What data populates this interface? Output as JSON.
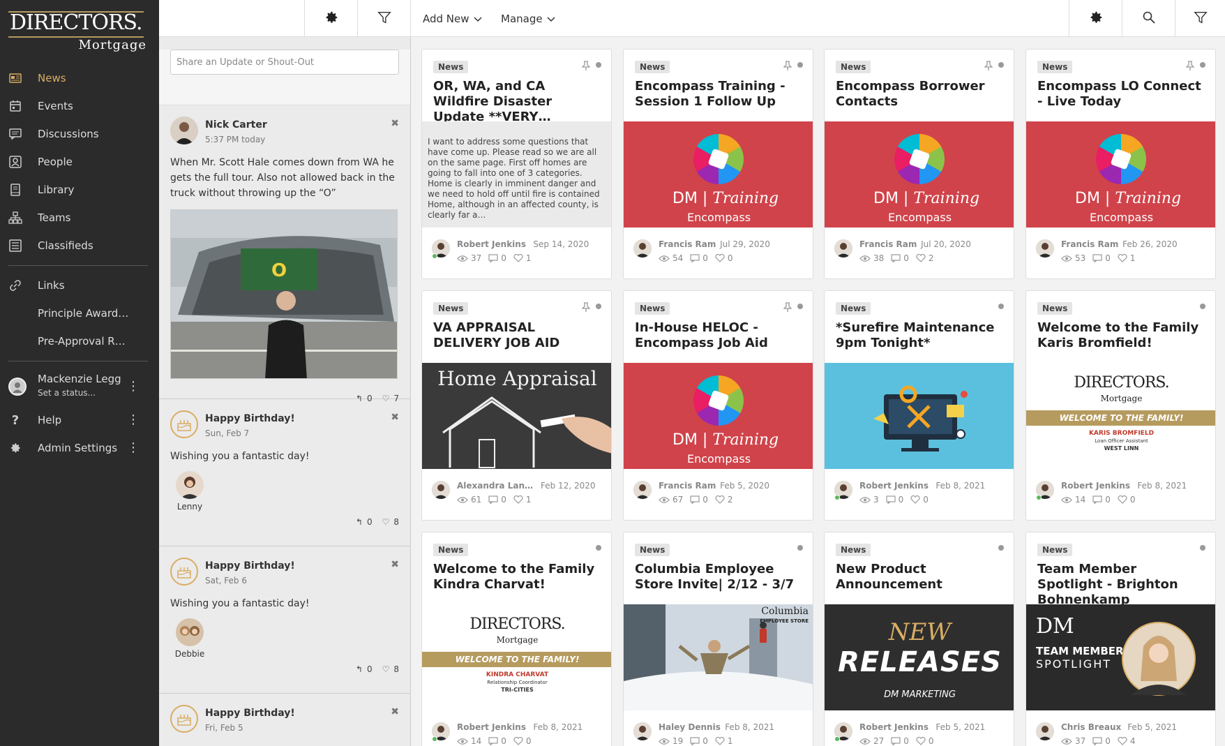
{
  "logo": {
    "top": "DIRECTORS.",
    "bottom": "Mortgage"
  },
  "nav": {
    "items": [
      {
        "label": "News",
        "icon": "newspaper-icon"
      },
      {
        "label": "Events",
        "icon": "calendar-icon"
      },
      {
        "label": "Discussions",
        "icon": "chat-icon"
      },
      {
        "label": "People",
        "icon": "person-icon"
      },
      {
        "label": "Library",
        "icon": "book-icon"
      },
      {
        "label": "Teams",
        "icon": "org-chart-icon"
      },
      {
        "label": "Classifieds",
        "icon": "list-icon"
      }
    ],
    "links_label": "Links",
    "link_items": [
      "Principle Award…",
      "Pre-Approval R…"
    ],
    "user": {
      "name": "Mackenzie Legg",
      "status": "Set a status..."
    },
    "help": "Help",
    "admin": "Admin Settings",
    "active_color": "#d9ad64"
  },
  "topbar": {
    "add_new": "Add New",
    "manage": "Manage"
  },
  "feed": {
    "share_placeholder": "Share an Update or Shout-Out",
    "post1": {
      "name": "Nick Carter",
      "time": "5:37 PM today",
      "text": "When Mr. Scott Hale comes down from WA he gets the full tour. Also not allowed back in the truck without throwing up the “O”",
      "replies": "0",
      "likes": "7"
    },
    "bday1": {
      "title": "Happy Birthday!",
      "date": "Sun, Feb 7",
      "text": "Wishing you a fantastic day!",
      "person": "Lenny",
      "replies": "0",
      "likes": "8"
    },
    "bday2": {
      "title": "Happy Birthday!",
      "date": "Sat, Feb 6",
      "text": "Wishing you a fantastic day!",
      "person": "Debbie",
      "replies": "0",
      "likes": "8"
    },
    "bday3": {
      "title": "Happy Birthday!",
      "date": "Fri, Feb 5"
    }
  },
  "media_text": {
    "dm": "DM",
    "training": "Training",
    "encompass": "Encompass",
    "home_appraisal": "Home Appraisal",
    "welcome_band": "WELCOME TO THE FAMILY!",
    "columbia": "Columbia",
    "columbia_sub": "EMPLOYEE STORE",
    "new": "NEW",
    "releases": "RELEASES",
    "marketing": "DM MARKETING",
    "team_member": "TEAM MEMBER",
    "spotlight": "SPOTLIGHT"
  },
  "cards": [
    {
      "tag": "News",
      "title": "OR, WA, and CA Wildfire Disaster Update **VERY…",
      "excerpt": "I want to address some questions that have come up. Please read so we are all on the same page.    First off homes are going to fall into one of 3 categories.    Home is clearly in imminent danger and we need to hold off until fire is contained Home, although in an affected county, is clearly far a…",
      "author": "Robert Jenkins",
      "date": "Sep 14, 2020",
      "views": "37",
      "comments": "0",
      "likes": "1"
    },
    {
      "tag": "News",
      "title": "Encompass Training - Session 1 Follow Up",
      "author": "Francis Ram",
      "date": "Jul 29, 2020",
      "views": "54",
      "comments": "0",
      "likes": "0"
    },
    {
      "tag": "News",
      "title": "Encompass Borrower Contacts",
      "author": "Francis Ram",
      "date": "Jul 20, 2020",
      "views": "38",
      "comments": "0",
      "likes": "2"
    },
    {
      "tag": "News",
      "title": "Encompass LO Connect - Live Today",
      "author": "Francis Ram",
      "date": "Feb 26, 2020",
      "views": "53",
      "comments": "0",
      "likes": "1"
    },
    {
      "tag": "News",
      "title": "VA APPRAISAL DELIVERY JOB AID",
      "author": "Alexandra Lande…",
      "date": "Feb 12, 2020",
      "views": "61",
      "comments": "0",
      "likes": "1"
    },
    {
      "tag": "News",
      "title": "In-House HELOC - Encompass Job Aid",
      "author": "Francis Ram",
      "date": "Feb 5, 2020",
      "views": "67",
      "comments": "0",
      "likes": "2"
    },
    {
      "tag": "News",
      "title": "*Surefire Maintenance 9pm Tonight*",
      "author": "Robert Jenkins",
      "date": "Feb 8, 2021",
      "views": "3",
      "comments": "0",
      "likes": "0"
    },
    {
      "tag": "News",
      "title": "Welcome to the Family Karis Bromfield!",
      "author": "Robert Jenkins",
      "date": "Feb 8, 2021",
      "views": "14",
      "comments": "0",
      "likes": "0",
      "wname": "KARIS BROMFIELD",
      "wrole": "Loan Officer Assistant",
      "wcity": "WEST LINN"
    },
    {
      "tag": "News",
      "title": "Welcome to the Family Kindra Charvat!",
      "author": "Robert Jenkins",
      "date": "Feb 8, 2021",
      "views": "14",
      "comments": "0",
      "likes": "0",
      "wname": "KINDRA CHARVAT",
      "wrole": "Relationship Coordinator",
      "wcity": "TRI-CITIES"
    },
    {
      "tag": "News",
      "title": "Columbia Employee Store Invite| 2/12 - 3/7",
      "author": "Haley Dennis",
      "date": "Feb 8, 2021",
      "views": "19",
      "comments": "0",
      "likes": "1"
    },
    {
      "tag": "News",
      "title": "New Product Announcement",
      "author": "Robert Jenkins",
      "date": "Feb 5, 2021",
      "views": "27",
      "comments": "0",
      "likes": "0"
    },
    {
      "tag": "News",
      "title": "Team Member Spotlight - Brighton Bohnenkamp",
      "author": "Chris Breaux",
      "date": "Feb 5, 2021",
      "views": "37",
      "comments": "0",
      "likes": "4"
    }
  ]
}
